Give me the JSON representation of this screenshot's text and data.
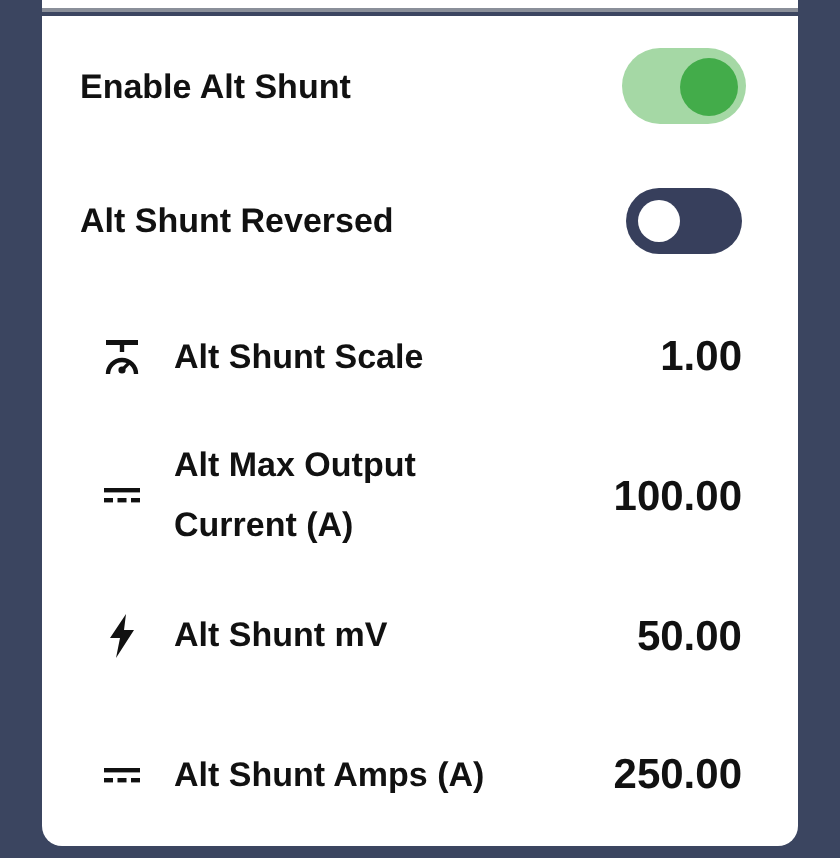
{
  "settings": [
    {
      "kind": "toggle",
      "label": "Enable Alt Shunt",
      "on": true
    },
    {
      "kind": "toggle",
      "label": "Alt Shunt Reversed",
      "on": false
    },
    {
      "kind": "scale",
      "label": "Alt Shunt Scale",
      "value": "1.00"
    },
    {
      "kind": "current",
      "label": "Alt Max Output Current (A)",
      "value": "100.00"
    },
    {
      "kind": "voltage",
      "label": "Alt Shunt mV",
      "value": "50.00"
    },
    {
      "kind": "current",
      "label": "Alt Shunt Amps (A)",
      "value": "250.00"
    }
  ]
}
